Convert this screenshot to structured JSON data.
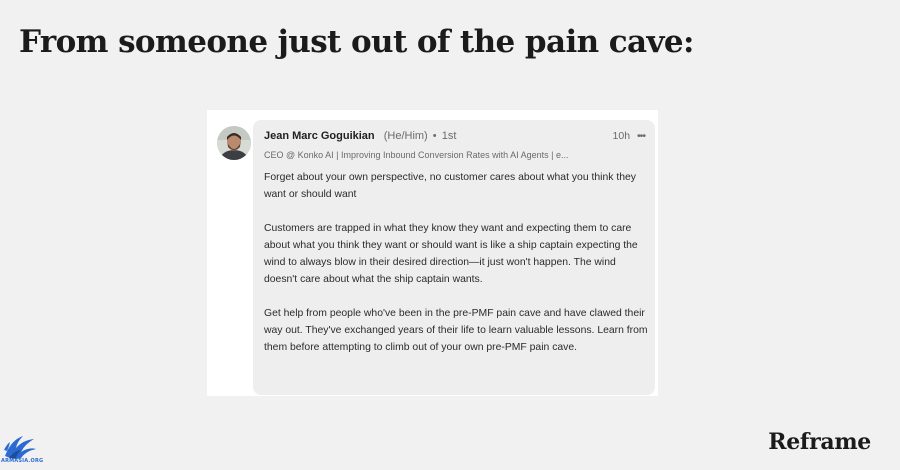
{
  "headline": "From someone just out of the pain cave:",
  "post": {
    "author_name": "Jean Marc Goguikian",
    "author_pronouns": "(He/Him)",
    "connection_degree": "1st",
    "time_ago": "10h",
    "author_headline": "CEO @ Konko AI | Improving Inbound Conversion Rates with AI Agents | e...",
    "paragraphs": [
      "Forget about your own perspective, no customer cares about what you think they want or should want",
      "Customers are trapped in what they know they want and expecting them to care about what you think they want or should want is like a ship captain expecting the wind to always blow in their desired direction—it just won't happen. The wind doesn't care about what the ship captain wants.",
      "Get help from people who've been in the pre-PMF pain cave and have clawed their way out. They've exchanged years of their life to learn valuable lessons. Learn from them before attempting to climb out of your own pre-PMF pain cave."
    ]
  },
  "footer": {
    "brand": "Reframe",
    "watermark": "ARMASIA.ORG"
  },
  "icons": {
    "more": "more-horizontal-icon",
    "avatar": "profile-photo",
    "logo": "bird-logo"
  },
  "colors": {
    "background": "#f1f1f1",
    "card": "#ffffff",
    "bubble": "#eeeeee",
    "logo_blue": "#2b6bd1"
  }
}
